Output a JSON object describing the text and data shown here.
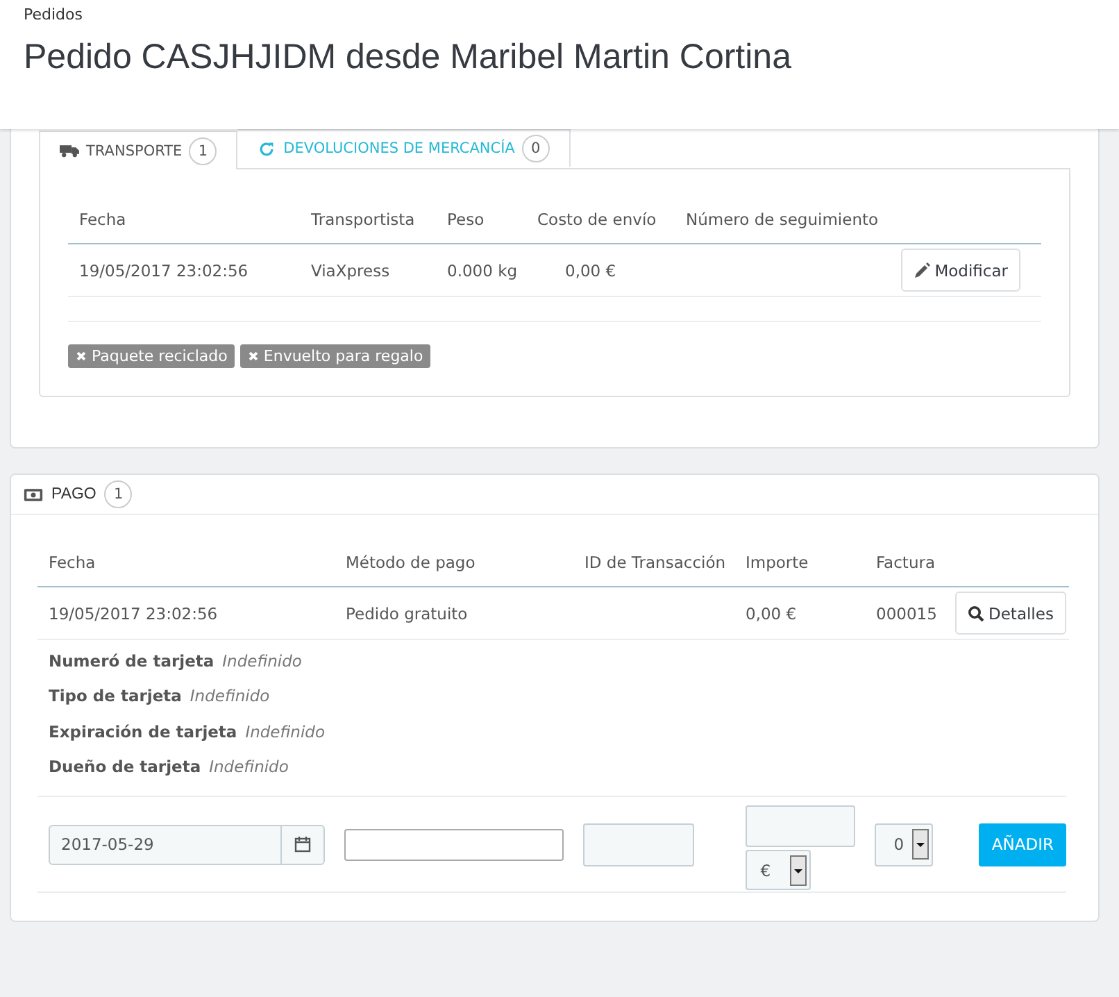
{
  "header": {
    "breadcrumb": "Pedidos",
    "title": "Pedido CASJHJIDM desde Maribel Martin Cortina"
  },
  "shipping_panel": {
    "tabs": [
      {
        "kind": "truck",
        "label": "TRANSPORTE",
        "count": "1",
        "selected": true
      },
      {
        "kind": "refresh",
        "label": "DEVOLUCIONES DE MERCANCÍA",
        "count": "0",
        "selected": false
      }
    ],
    "table": {
      "columns": [
        "Fecha",
        "Transportista",
        "Peso",
        "Costo de envío",
        "Número de seguimiento"
      ],
      "rows": [
        {
          "cells": [
            "19/05/2017 23:02:56",
            "ViaXpress",
            "0.000 kg",
            "0,00 €",
            ""
          ],
          "action": "Modificar"
        }
      ]
    },
    "tags": [
      "Paquete reciclado",
      "Envuelto para regalo"
    ]
  },
  "payment_panel": {
    "title": "PAGO",
    "count": "1",
    "table": {
      "columns": [
        "Fecha",
        "Método de pago",
        "ID de Transacción",
        "Importe",
        "Factura"
      ],
      "rows": [
        {
          "cells": [
            "19/05/2017 23:02:56",
            "Pedido gratuito",
            "",
            "0,00 €",
            "000015"
          ],
          "action": "Detalles"
        }
      ]
    },
    "card_details": [
      {
        "label": "Numeró de tarjeta",
        "value": "Indefinido"
      },
      {
        "label": "Tipo de tarjeta",
        "value": "Indefinido"
      },
      {
        "label": "Expiración de tarjeta",
        "value": "Indefinido"
      },
      {
        "label": "Dueño de tarjeta",
        "value": "Indefinido"
      }
    ],
    "form": {
      "date": "2017-05-29",
      "currency": "€",
      "invoice": "0",
      "submit": "AÑADIR"
    }
  }
}
